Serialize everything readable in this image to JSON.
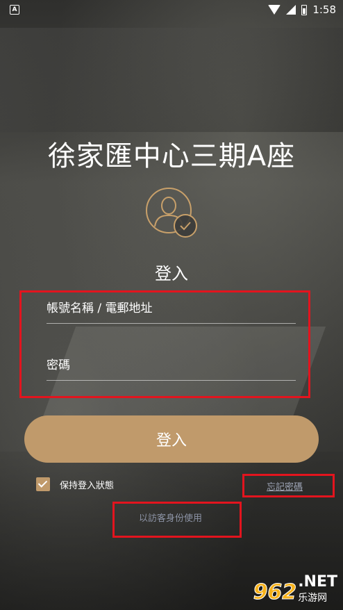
{
  "status_bar": {
    "app_icon": "A",
    "time": "1:58"
  },
  "app": {
    "title": "徐家匯中心三期A座",
    "login_heading": "登入"
  },
  "form": {
    "account_placeholder": "帳號名稱 / 電郵地址",
    "password_placeholder": "密碼",
    "login_button": "登入",
    "remember_label": "保持登入狀態",
    "remember_checked": true,
    "forgot_link": "忘記密碼",
    "guest_link": "以訪客身份使用"
  },
  "watermark": {
    "number": "962",
    "suffix": ".NET",
    "subtitle": "乐游网"
  },
  "colors": {
    "accent": "#c09a6b",
    "highlight_box": "#e3141e"
  }
}
